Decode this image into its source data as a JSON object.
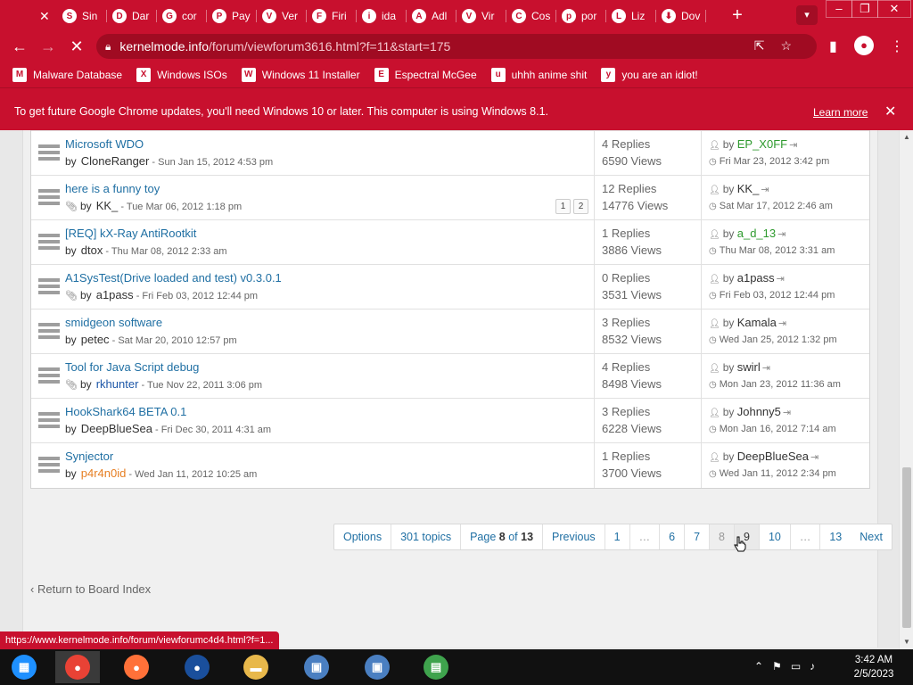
{
  "browser": {
    "tabs": [
      {
        "label": "",
        "icon": "close-icon",
        "glyph": "✕"
      },
      {
        "label": "Sin",
        "icon": "chrome-tab-icon",
        "glyph": "S"
      },
      {
        "label": "Dar",
        "icon": "chrome-tab-icon",
        "glyph": "D"
      },
      {
        "label": "cor",
        "icon": "github-icon",
        "glyph": "G"
      },
      {
        "label": "Pay",
        "icon": "chrome-tab-icon",
        "glyph": "P"
      },
      {
        "label": "Ver",
        "icon": "chrome-tab-icon",
        "glyph": "V"
      },
      {
        "label": "Firi",
        "icon": "chrome-tab-icon",
        "glyph": "F"
      },
      {
        "label": "ida",
        "icon": "chrome-tab-icon",
        "glyph": "i"
      },
      {
        "label": "Adl",
        "icon": "chrome-tab-icon",
        "glyph": "A"
      },
      {
        "label": "Vir",
        "icon": "chrome-tab-icon",
        "glyph": "V"
      },
      {
        "label": "Cos",
        "icon": "chrome-tab-icon",
        "glyph": "C"
      },
      {
        "label": "por",
        "icon": "chrome-tab-icon",
        "glyph": "p"
      },
      {
        "label": "Liz",
        "icon": "chrome-tab-icon",
        "glyph": "L"
      },
      {
        "label": "Dov",
        "icon": "download-icon",
        "glyph": "⬇"
      }
    ],
    "new_tab": "+",
    "url_host": "kernelmode.info",
    "url_path": "/forum/viewforum3616.html?f=11&start=175",
    "bookmarks": [
      {
        "label": "Malware Database",
        "glyph": "M"
      },
      {
        "label": "Windows ISOs",
        "glyph": "X"
      },
      {
        "label": "Windows 11 Installer",
        "glyph": "W"
      },
      {
        "label": "Espectral McGee",
        "glyph": "E"
      },
      {
        "label": "uhhh anime shit",
        "glyph": "u"
      },
      {
        "label": "you are an idiot!",
        "glyph": "y"
      }
    ],
    "infobar": {
      "message": "To get future Google Chrome updates, you'll need Windows 10 or later. This computer is using Windows 8.1.",
      "learn_more": "Learn more"
    },
    "status_url": "https://www.kernelmode.info/forum/viewforumc4d4.html?f=1..."
  },
  "topics": [
    {
      "title": "Microsoft WDO",
      "by": "by",
      "author": "CloneRanger",
      "author_color": "",
      "attachment": false,
      "date": "- Sun Jan 15, 2012 4:53 pm",
      "replies": "4 Replies",
      "views": "6590 Views",
      "last_user": "EP_X0FF",
      "last_user_color": "green",
      "last_date": "Fri Mar 23, 2012 3:42 pm",
      "pages": []
    },
    {
      "title": "here is a funny toy",
      "by": "by",
      "author": "KK_",
      "author_color": "",
      "attachment": true,
      "date": "- Tue Mar 06, 2012 1:18 pm",
      "replies": "12 Replies",
      "views": "14776 Views",
      "last_user": "KK_",
      "last_user_color": "",
      "last_date": "Sat Mar 17, 2012 2:46 am",
      "pages": [
        "1",
        "2"
      ]
    },
    {
      "title": "[REQ] kX-Ray AntiRootkit",
      "by": "by",
      "author": "dtox",
      "author_color": "",
      "attachment": false,
      "date": "- Thu Mar 08, 2012 2:33 am",
      "replies": "1 Replies",
      "views": "3886 Views",
      "last_user": "a_d_13",
      "last_user_color": "green",
      "last_date": "Thu Mar 08, 2012 3:31 am",
      "pages": []
    },
    {
      "title": "A1SysTest(Drive loaded and test) v0.3.0.1",
      "by": "by",
      "author": "a1pass",
      "author_color": "",
      "attachment": true,
      "date": "- Fri Feb 03, 2012 12:44 pm",
      "replies": "0 Replies",
      "views": "3531 Views",
      "last_user": "a1pass",
      "last_user_color": "",
      "last_date": "Fri Feb 03, 2012 12:44 pm",
      "pages": []
    },
    {
      "title": "smidgeon software",
      "by": "by",
      "author": "petec",
      "author_color": "",
      "attachment": false,
      "date": "- Sat Mar 20, 2010 12:57 pm",
      "replies": "3 Replies",
      "views": "8532 Views",
      "last_user": "Kamala",
      "last_user_color": "",
      "last_date": "Wed Jan 25, 2012 1:32 pm",
      "pages": []
    },
    {
      "title": "Tool for Java Script debug",
      "by": "by",
      "author": "rkhunter",
      "author_color": "blue",
      "attachment": true,
      "date": "- Tue Nov 22, 2011 3:06 pm",
      "replies": "4 Replies",
      "views": "8498 Views",
      "last_user": "swirl",
      "last_user_color": "",
      "last_date": "Mon Jan 23, 2012 11:36 am",
      "pages": []
    },
    {
      "title": "HookShark64 BETA 0.1",
      "by": "by",
      "author": "DeepBlueSea",
      "author_color": "",
      "attachment": false,
      "date": "- Fri Dec 30, 2011 4:31 am",
      "replies": "3 Replies",
      "views": "6228 Views",
      "last_user": "Johnny5",
      "last_user_color": "",
      "last_date": "Mon Jan 16, 2012 7:14 am",
      "pages": []
    },
    {
      "title": "Synjector",
      "by": "by",
      "author": "p4r4n0id",
      "author_color": "orange",
      "attachment": false,
      "date": "- Wed Jan 11, 2012 10:25 am",
      "replies": "1 Replies",
      "views": "3700 Views",
      "last_user": "DeepBlueSea",
      "last_user_color": "",
      "last_date": "Wed Jan 11, 2012 2:34 pm",
      "pages": []
    }
  ],
  "pagination": {
    "options": "Options",
    "topics": "301 topics",
    "page_prefix": "Page",
    "page_current": "8",
    "page_of": "of",
    "page_total": "13",
    "previous": "Previous",
    "pages": [
      "1",
      "…",
      "6",
      "7",
      "8",
      "9",
      "10",
      "…",
      "13"
    ],
    "current": "8",
    "hovered": "9",
    "next": "Next"
  },
  "back_link": "Return to Board Index",
  "taskbar": {
    "apps": [
      {
        "name": "start-icon",
        "glyph": "▦",
        "color": "#1e90ff"
      },
      {
        "name": "chrome-icon",
        "glyph": "●",
        "color": "#e94235"
      },
      {
        "name": "firefox-icon",
        "glyph": "●",
        "color": "#ff7139"
      },
      {
        "name": "obama-logo-icon",
        "glyph": "●",
        "color": "#1a4f9c"
      },
      {
        "name": "file-explorer-icon",
        "glyph": "▬",
        "color": "#e8b84b"
      },
      {
        "name": "network-setup-icon",
        "glyph": "▣",
        "color": "#4a7fc1"
      },
      {
        "name": "network-setup-icon-2",
        "glyph": "▣",
        "color": "#4a7fc1"
      },
      {
        "name": "chart-app-icon",
        "glyph": "▤",
        "color": "#3fa34d"
      }
    ],
    "time": "3:42 AM",
    "date": "2/5/2023"
  }
}
